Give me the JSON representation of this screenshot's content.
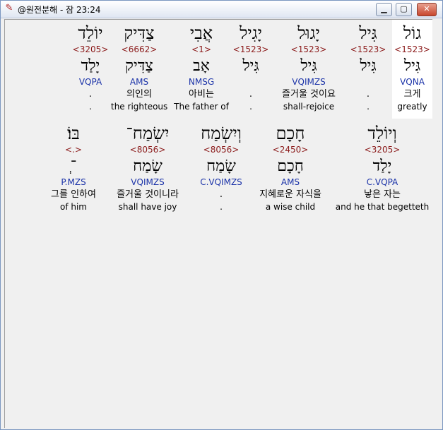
{
  "window": {
    "title": "@원전분해 - 잠 23:24",
    "buttons": [
      "minimize",
      "maximize",
      "close"
    ]
  },
  "rows": [
    [
      {
        "heb": "יוֹלֵד",
        "strong": "<3205>",
        "lemma": "יָלַד",
        "morph": "VQPA",
        "kor": ".",
        "eng": "."
      },
      {
        "heb": "צַדִּיק",
        "strong": "<6662>",
        "lemma": "צַדִּיק",
        "morph": "AMS",
        "kor": "의인의",
        "eng": "the righteous"
      },
      {
        "heb": "אֲבִי",
        "strong": "<1>",
        "lemma": "אָב",
        "morph": "NMSG",
        "kor": "아비는",
        "eng": "The father of"
      },
      {
        "heb": "יָגִיל",
        "strong": "<1523>",
        "lemma": "גִּיל",
        "morph": "",
        "kor": ".",
        "eng": "."
      },
      {
        "heb": "יָגוּל",
        "strong": "<1523>",
        "lemma": "גִּיל",
        "morph": "VQIMZS",
        "kor": "즐거울 것이요",
        "eng": "shall-rejoice"
      },
      {
        "heb": "גִּיל",
        "strong": "<1523>",
        "lemma": "גִּיל",
        "morph": "",
        "kor": ".",
        "eng": "."
      },
      {
        "heb": "גוֹל",
        "strong": "<1523>",
        "lemma": "גִּיל",
        "morph": "VQNA",
        "kor": "크게",
        "eng": "greatly"
      }
    ],
    [
      {
        "heb": "בּוֹ׃",
        "strong": "<.>",
        "lemma": "־ְ",
        "morph": "P.MZS",
        "kor": "그를 인하여",
        "eng": "of him"
      },
      {
        "heb": "יִשְׂמַח־",
        "strong": "<8056>",
        "lemma": "שָׂמַח",
        "morph": "VQIMZS",
        "kor": "즐거울 것이니라",
        "eng": "shall have joy"
      },
      {
        "heb": "וְיִשְׂמַח",
        "strong": "<8056>",
        "lemma": "שָׂמַח",
        "morph": "C.VQIMZS",
        "kor": ".",
        "eng": "."
      },
      {
        "heb": "חָכָם",
        "strong": "<2450>",
        "lemma": "חָכָם",
        "morph": "AMS",
        "kor": "지혜로운 자식을",
        "eng": "a wise child"
      },
      {
        "heb": "וְיוֹלֵד",
        "strong": "<3205>",
        "lemma": "יָלַד",
        "morph": "C.VQPA",
        "kor": "낳은 자는",
        "eng": "and he that begetteth"
      }
    ]
  ]
}
